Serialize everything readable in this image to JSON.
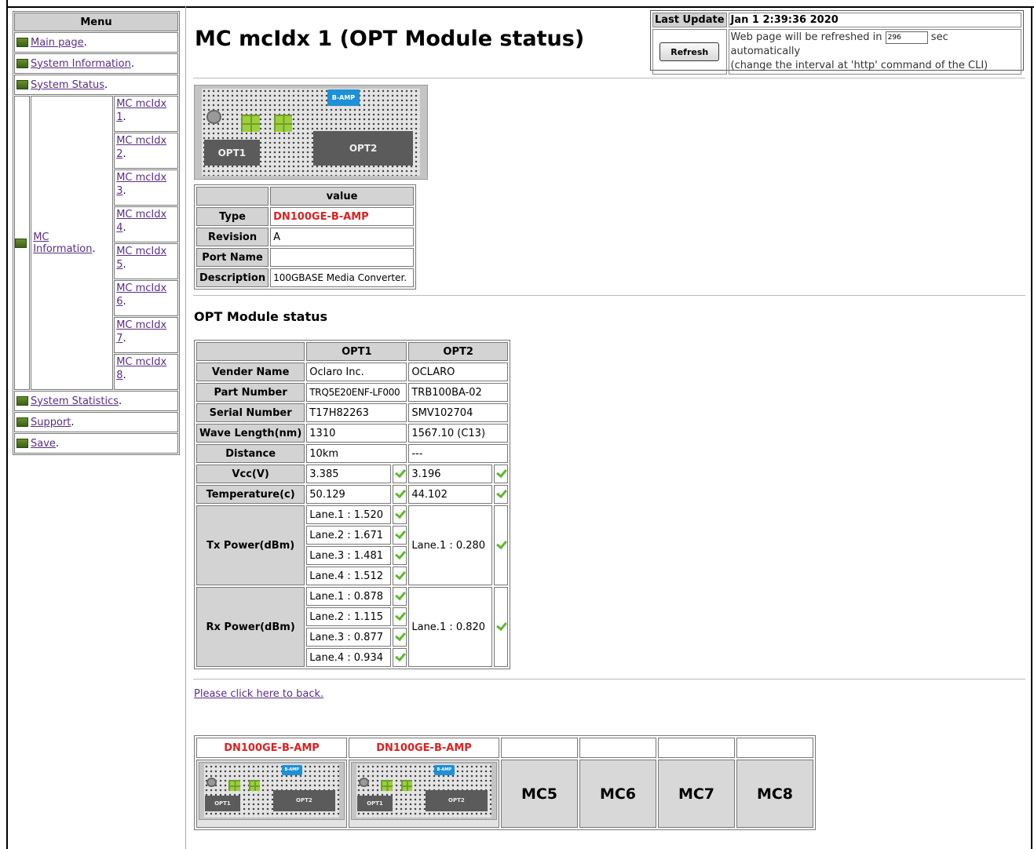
{
  "menu": {
    "title": "Menu",
    "items": [
      {
        "label": "Main page",
        "suffix": "."
      },
      {
        "label": "System Information",
        "suffix": "."
      },
      {
        "label": "System Status",
        "suffix": "."
      }
    ],
    "mc_information": {
      "label": "MC Information",
      "suffix": "."
    },
    "mc_items": [
      {
        "line1": "MC mcIdx",
        "line2": "1",
        "suffix": "."
      },
      {
        "line1": "MC mcIdx",
        "line2": "2",
        "suffix": "."
      },
      {
        "line1": "MC mcIdx",
        "line2": "3",
        "suffix": "."
      },
      {
        "line1": "MC mcIdx",
        "line2": "4",
        "suffix": "."
      },
      {
        "line1": "MC mcIdx",
        "line2": "5",
        "suffix": "."
      },
      {
        "line1": "MC mcIdx",
        "line2": "6",
        "suffix": "."
      },
      {
        "line1": "MC mcIdx",
        "line2": "7",
        "suffix": "."
      },
      {
        "line1": "MC mcIdx",
        "line2": "8",
        "suffix": "."
      }
    ],
    "bottom_items": [
      {
        "label": "System Statistics",
        "suffix": "."
      },
      {
        "label": "Support",
        "suffix": "."
      },
      {
        "label": "Save",
        "suffix": "."
      }
    ]
  },
  "header": {
    "title": "MC mcIdx 1 (OPT Module status)"
  },
  "update": {
    "last_update_label": "Last Update",
    "last_update_value": "Jan 1 2:39:36 2020",
    "refresh_label": "Refresh",
    "text_before": "Web page will be refreshed in",
    "interval_value": "296",
    "text_after": "sec automatically",
    "text_line2": "(change the interval at 'http' command of the CLI)"
  },
  "device": {
    "badge": "B-AMP",
    "port1": "OPT1",
    "port2": "OPT2"
  },
  "info_table": {
    "header": "value",
    "rows": [
      {
        "label": "Type",
        "value": "DN100GE-B-AMP"
      },
      {
        "label": "Revision",
        "value": "A"
      },
      {
        "label": "Port Name",
        "value": ""
      },
      {
        "label": "Description",
        "value": "100GBASE Media Converter."
      }
    ]
  },
  "opt_section": {
    "title": "OPT Module status",
    "col1": "OPT1",
    "col2": "OPT2",
    "rows": [
      {
        "label": "Vender Name",
        "opt1": "Oclaro Inc.",
        "opt2": "OCLARO"
      },
      {
        "label": "Part Number",
        "opt1": "TRQ5E20ENF-LF000",
        "opt2": "TRB100BA-02"
      },
      {
        "label": "Serial Number",
        "opt1": "T17H82263",
        "opt2": "SMV102704"
      },
      {
        "label": "Wave Length(nm)",
        "opt1": "1310",
        "opt2": "1567.10 (C13)"
      },
      {
        "label": "Distance",
        "opt1": "10km",
        "opt2": "---"
      }
    ],
    "checked_rows": [
      {
        "label": "Vcc(V)",
        "opt1": "3.385",
        "opt2": "3.196"
      },
      {
        "label": "Temperature(c)",
        "opt1": "50.129",
        "opt2": "44.102"
      }
    ],
    "tx": {
      "label": "Tx Power(dBm)",
      "opt1": [
        "Lane.1 : 1.520",
        "Lane.2 : 1.671",
        "Lane.3 : 1.481",
        "Lane.4 : 1.512"
      ],
      "opt2": "Lane.1 : 0.280"
    },
    "rx": {
      "label": "Rx Power(dBm)",
      "opt1": [
        "Lane.1 : 0.878",
        "Lane.2 : 1.115",
        "Lane.3 : 0.877",
        "Lane.4 : 0.934"
      ],
      "opt2": "Lane.1 : 0.820"
    },
    "status_color": "#5db82c"
  },
  "back_link": "Please click here to back.",
  "mc_bar": {
    "slot1": "DN100GE-B-AMP",
    "slot2": "DN100GE-B-AMP",
    "slot5": "MC5",
    "slot6": "MC6",
    "slot7": "MC7",
    "slot8": "MC8"
  },
  "colors": {
    "accent_red": "#e02020",
    "badge_blue": "#1e90d6",
    "header_gray": "#d3d3d3",
    "link": "#5a2d8a"
  }
}
